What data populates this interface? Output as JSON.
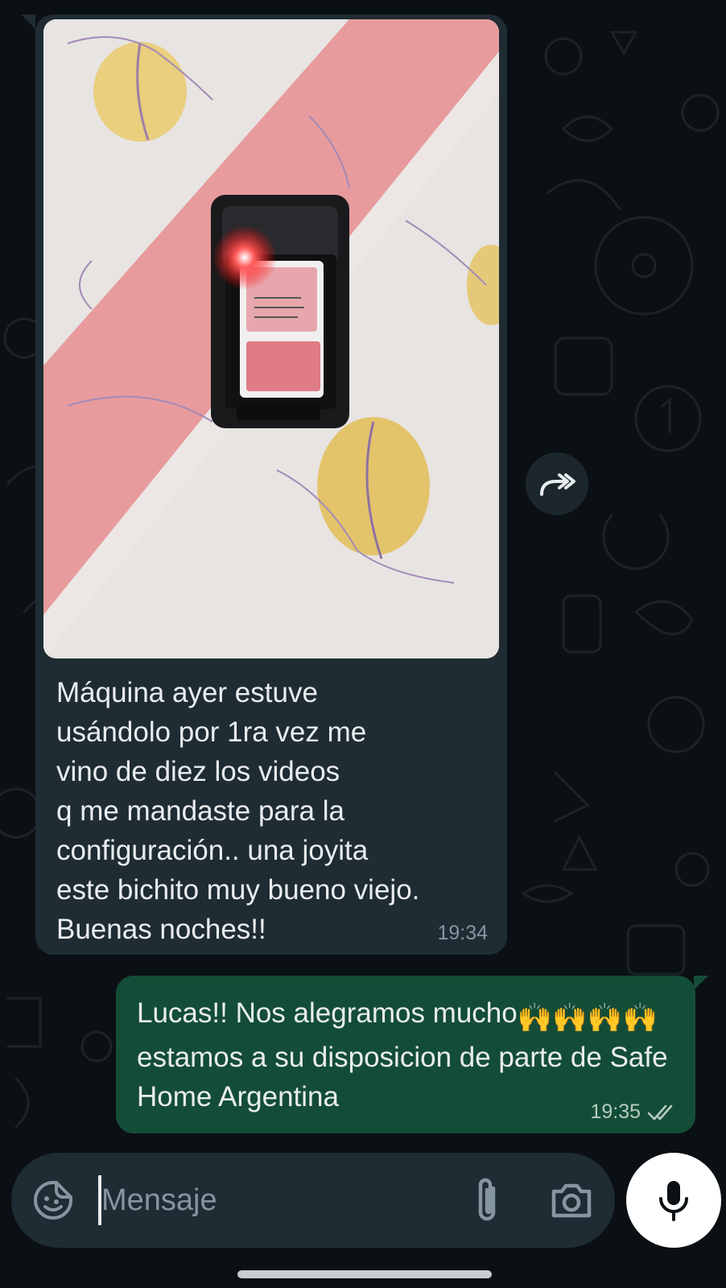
{
  "theme": {
    "background": "#0b1014",
    "incoming_bubble": "#1f2c33",
    "outgoing_bubble": "#144d37",
    "text": "#e9edef",
    "meta_text": "#8696a0",
    "read_ticks": "#b5cbc1"
  },
  "messages": {
    "incoming": {
      "image_description_icon": "photo-sim-card-tracker",
      "text": "Máquina ayer estuve\nusándolo por 1ra vez me\nvino de diez los videos\nq me mandaste para la\nconfiguración.. una joyita\neste bichito muy bueno viejo.\nBuenas noches!!",
      "time": "19:34"
    },
    "outgoing": {
      "text": "Lucas!! Nos alegramos mucho",
      "text_rest": "estamos a su disposicion de parte de Safe Home Argentina",
      "emoji": "🙌🙌🙌🙌",
      "time": "19:35",
      "status_icon": "double-check-icon"
    }
  },
  "forward": {
    "icon": "forward-icon"
  },
  "composer": {
    "placeholder": "Mensaje",
    "value": "",
    "sticker_icon": "sticker-icon",
    "attach_icon": "paperclip-icon",
    "camera_icon": "camera-icon",
    "mic_icon": "microphone-icon"
  }
}
